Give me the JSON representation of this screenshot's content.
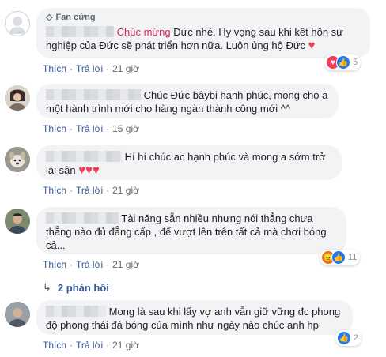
{
  "comments": [
    {
      "badge": "Fan cứng",
      "highlight": "Chúc mừng",
      "text": " Đức nhé. Hy vọng sau khi kết hôn sự nghiệp của Đức sẽ phát triển hơn nữa. Luôn ủng hộ Đức ",
      "like_label": "Thích",
      "reply_label": "Trả lời",
      "time": "21 giờ",
      "reaction_count": "5"
    },
    {
      "text": "Chúc Đức bâybi hạnh phúc, mong cho a một hành trình mới cho hàng ngàn thành công mới ^^",
      "like_label": "Thích",
      "reply_label": "Trả lời",
      "time": "15 giờ"
    },
    {
      "text": "Hí hí chúc ac hạnh phúc và mong a sớm trở lại sân ",
      "like_label": "Thích",
      "reply_label": "Trả lời",
      "time": "21 giờ"
    },
    {
      "text": "Tài năng sẵn nhiều nhưng nói thẳng chưa thẳng nào đủ đẳng cấp , để vượt lên trên tất cả mà chơi bóng cả...",
      "more": "...",
      "like_label": "Thích",
      "reply_label": "Trả lời",
      "time": "21 giờ",
      "reaction_count": "11"
    },
    {
      "text": "Mong là sau khi lấy vợ anh vẫn giữ vững đc phong độ phong thái đá bóng của mình như ngày nào chúc anh hp",
      "like_label": "Thích",
      "reply_label": "Trả lời",
      "time": "21 giờ",
      "reaction_count": "2"
    }
  ],
  "replies_label": "2 phản hồi",
  "colors": {
    "link": "#385898",
    "bubble": "#f2f3f5",
    "like": "#2078f4",
    "love": "#f33e58"
  }
}
